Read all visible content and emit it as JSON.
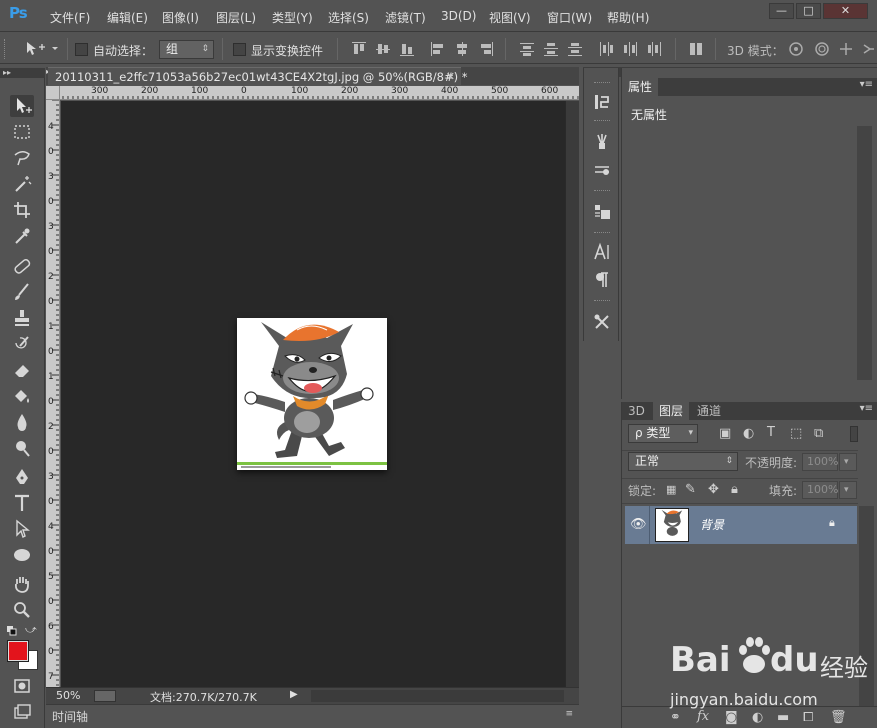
{
  "app": {
    "logo": "Ps"
  },
  "menu": [
    "文件(F)",
    "编辑(E)",
    "图像(I)",
    "图层(L)",
    "类型(Y)",
    "选择(S)",
    "滤镜(T)",
    "3D(D)",
    "视图(V)",
    "窗口(W)",
    "帮助(H)"
  ],
  "window_buttons": [
    "—",
    "□",
    "✕"
  ],
  "options": {
    "auto_select_label": "自动选择：",
    "auto_select_value": "组",
    "show_transform_label": "显示变换控件",
    "mode_3d_label": "3D 模式："
  },
  "document": {
    "tab_title": "20110311_e2ffc71053a56b27ec01wt43CE4X2tgJ.jpg @ 50%(RGB/8#) *",
    "zoom": "50%",
    "doc_size": "文档:270.7K/270.7K"
  },
  "ruler": {
    "h_labels": [
      "300",
      "200",
      "100",
      "0",
      "100",
      "200",
      "300",
      "400",
      "500",
      "600"
    ],
    "v_labels": [
      "4",
      "0",
      "3",
      "0",
      "3",
      "0",
      "2",
      "0",
      "1",
      "0",
      "1",
      "0",
      "2",
      "0",
      "3",
      "0",
      "4",
      "0",
      "5",
      "0",
      "6",
      "0",
      "7"
    ]
  },
  "timeline": {
    "label": "时间轴"
  },
  "properties": {
    "tab": "属性",
    "content": "无属性"
  },
  "layers": {
    "tabs": [
      "3D",
      "图层",
      "通道"
    ],
    "active_tab": "图层",
    "filter_label": "ρ 类型",
    "blend_mode": "正常",
    "opacity_label": "不透明度:",
    "opacity_value": "100%",
    "lock_label": "锁定:",
    "fill_label": "填充:",
    "fill_value": "100%",
    "layer_name": "背景"
  },
  "watermark": {
    "brand": "Bai",
    "brand2": "du",
    "suffix": "经验",
    "url": "jingyan.baidu.com"
  },
  "colors": {
    "foreground": "#e3141c",
    "background": "#ffffff",
    "accent": "#3a9de9",
    "selected_layer": "#697b93"
  }
}
